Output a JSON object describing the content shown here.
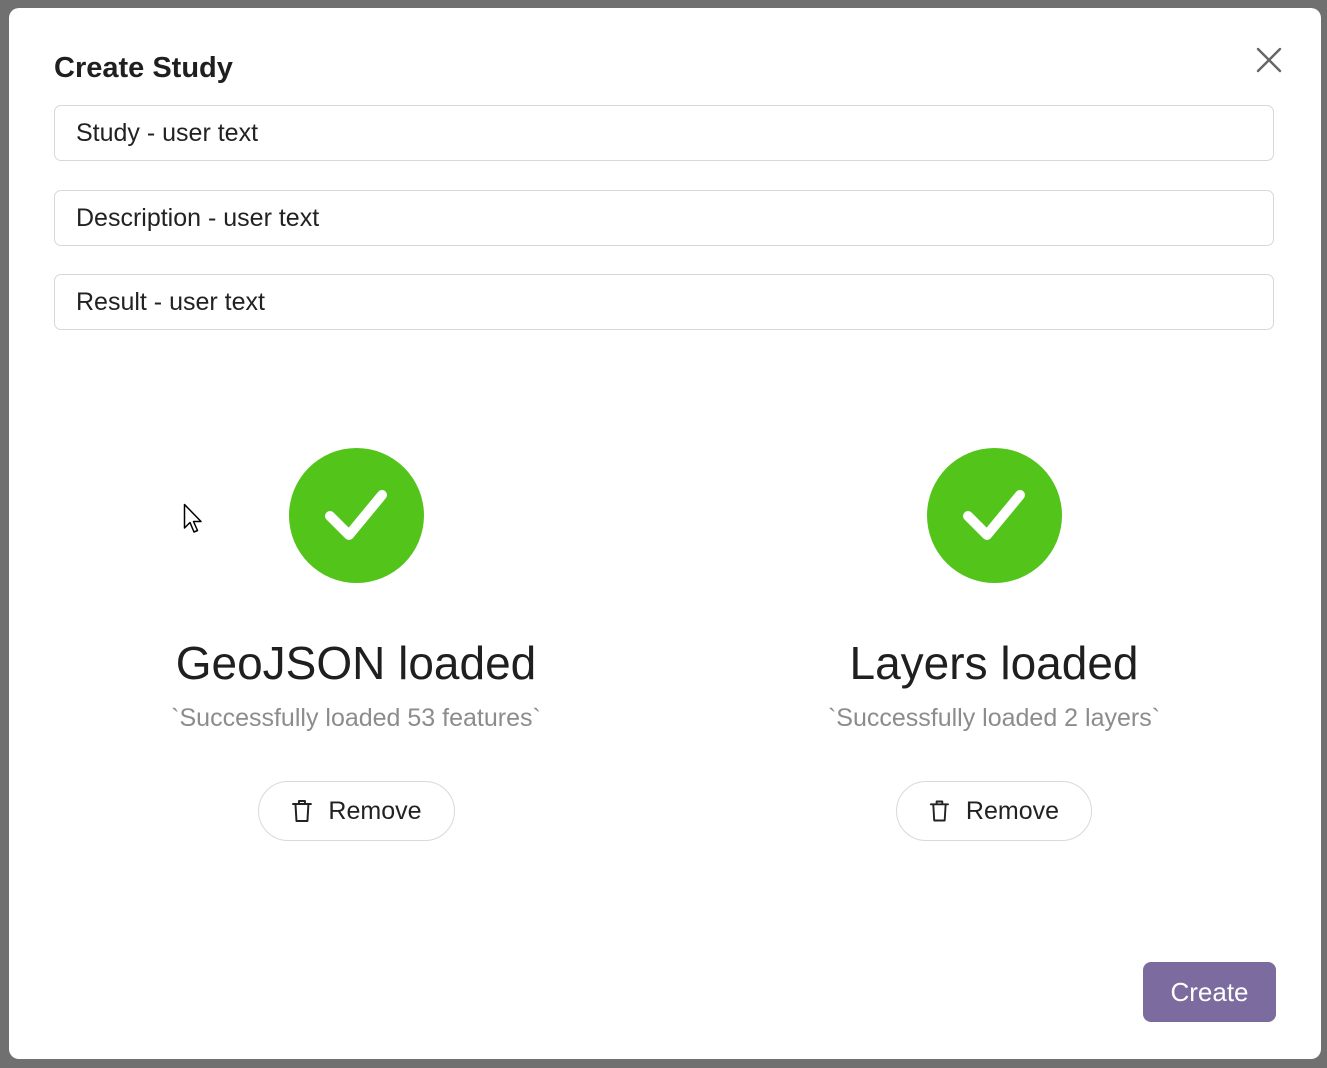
{
  "dialog": {
    "title": "Create Study",
    "close_icon": "close-icon"
  },
  "fields": {
    "study_placeholder": "Study - user text",
    "description_placeholder": "Description - user text",
    "result_placeholder": "Result - user text"
  },
  "geojson": {
    "icon": "check-circle-icon",
    "title": "GeoJSON loaded",
    "subtitle": "`Successfully loaded 53 features`",
    "remove_label": "Remove",
    "remove_icon": "trash-icon"
  },
  "layers": {
    "icon": "check-circle-icon",
    "title": "Layers loaded",
    "subtitle": "`Successfully loaded 2 layers`",
    "remove_label": "Remove",
    "remove_icon": "trash-icon"
  },
  "footer": {
    "create_label": "Create"
  },
  "colors": {
    "success": "#52c41a",
    "primary": "#7b6b9f",
    "muted_text": "#8c8c8c"
  }
}
